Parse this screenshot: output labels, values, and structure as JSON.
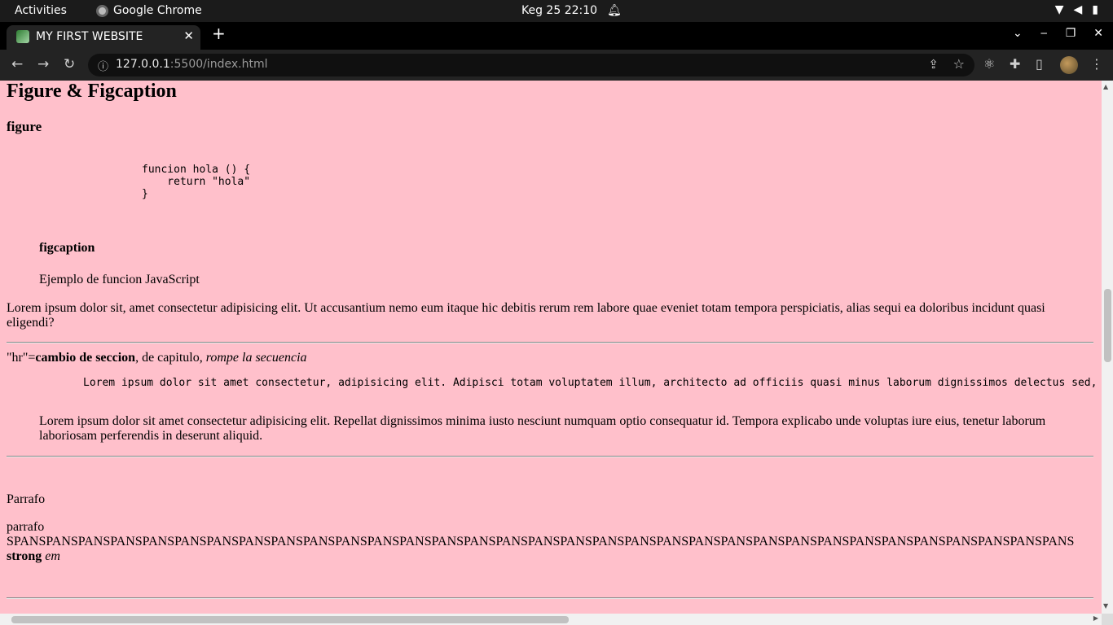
{
  "system_bar": {
    "activities": "Activities",
    "app_name": "Google Chrome",
    "clock": "Keg 25  22:10"
  },
  "browser": {
    "tab_title": "MY FIRST WEBSITE",
    "url_host": "127.0.0.1",
    "url_rest": ":5500/index.html"
  },
  "page": {
    "heading": "Figure & Figcaption",
    "figure_label": "figure",
    "code_lines": [
      "funcion hola () {",
      "    return \"hola\"",
      "}"
    ],
    "figcaption_label": "figcaption",
    "figcaption_text": "Ejemplo de funcion JavaScript",
    "lorem_1": "Lorem ipsum dolor sit, amet consectetur adipisicing elit. Ut accusantium nemo eum itaque hic debitis rerum rem labore quae eveniet totam tempora perspiciatis, alias sequi ea doloribus incidunt quasi eligendi?",
    "hr_prefix": "\"hr\"=",
    "hr_bold": "cambio de seccion",
    "hr_middle": ", de capitulo, ",
    "hr_italic": "rompe la secuencia",
    "pre_lorem": "Lorem ipsum dolor sit amet consectetur, adipisicing elit. Adipisci totam voluptatem illum, architecto ad officiis quasi minus laborum dignissimos delectus sed,",
    "blockquote": "Lorem ipsum dolor sit amet consectetur adipisicing elit. Repellat dignissimos minima iusto nesciunt numquam optio consequatur id. Tempora explicabo unde voluptas iure eius, tenetur laborum laboriosam perferendis in deserunt aliquid.",
    "parrafo_heading": "Parrafo",
    "parrafo": "parrafo",
    "span_text": "SPANSPANSPANSPANSPANSPANSPANSPANSPANSPANSPANSPANSPANSPANSPANSPANSPANSPANSPANSPANSPANSPANSPANSPANSPANSPANSPANSPANSPANSPANSPANSPANSPANS",
    "strong": "strong",
    "em": "em"
  }
}
